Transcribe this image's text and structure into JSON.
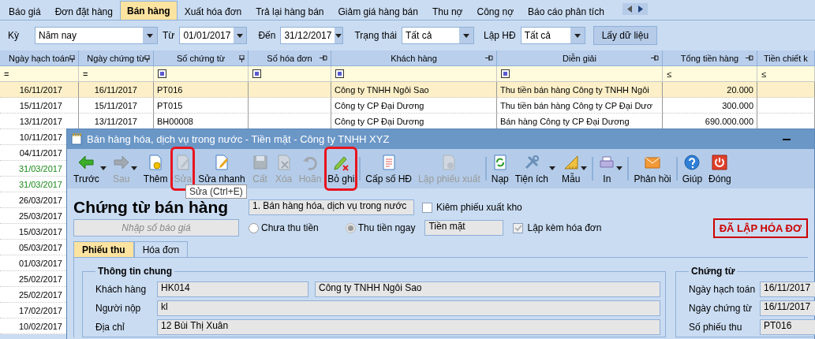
{
  "tabs": [
    {
      "label": "Báo giá",
      "selected": false
    },
    {
      "label": "Đơn đặt hàng",
      "selected": false
    },
    {
      "label": "Bán hàng",
      "selected": true
    },
    {
      "label": "Xuất hóa đơn",
      "selected": false
    },
    {
      "label": "Trả lại hàng bán",
      "selected": false
    },
    {
      "label": "Giảm giá hàng bán",
      "selected": false
    },
    {
      "label": "Thu nợ",
      "selected": false
    },
    {
      "label": "Công nợ",
      "selected": false
    },
    {
      "label": "Báo cáo phân tích",
      "selected": false
    }
  ],
  "filters": {
    "period_label": "Kỳ",
    "period": "Năm nay",
    "from_label": "Từ",
    "from": "01/01/2017",
    "to_label": "Đến",
    "to": "31/12/2017",
    "status_label": "Trạng thái",
    "status": "Tất cả",
    "invoice_label": "Lập HĐ",
    "invoice": "Tất cả",
    "button": "Lấy dữ liệu"
  },
  "table": {
    "columns": [
      {
        "label": "Ngày hạch toán",
        "pinned": true,
        "filter": {
          "kind": "text",
          "text": "="
        }
      },
      {
        "label": "Ngày chứng từ",
        "pinned": true,
        "filter": {
          "kind": "text",
          "text": "="
        }
      },
      {
        "label": "Số chứng từ",
        "pinned": true,
        "filter": {
          "kind": "box"
        }
      },
      {
        "label": "Số hóa đơn",
        "pinned": false,
        "filter": {
          "kind": "box"
        }
      },
      {
        "label": "Khách hàng",
        "pinned": false,
        "filter": {
          "kind": "box"
        }
      },
      {
        "label": "Diễn giải",
        "pinned": false,
        "filter": {
          "kind": "box"
        }
      },
      {
        "label": "Tổng tiền hàng",
        "pinned": false,
        "filter": {
          "kind": "text",
          "text": "≤"
        }
      },
      {
        "label": "Tiền chiết k",
        "filter": {
          "kind": "text",
          "text": "≤"
        }
      }
    ],
    "rows": [
      {
        "selected": true,
        "posting_date": "16/11/2017",
        "doc_date": "16/11/2017",
        "doc_no": "PT016",
        "customer": "Công ty TNHH Ngôi Sao",
        "description": "Thu tiền bán hàng Công ty TNHH Ngôi",
        "total": "20.000"
      },
      {
        "selected": false,
        "posting_date": "15/11/2017",
        "doc_date": "15/11/2017",
        "doc_no": "PT015",
        "customer": "Công ty CP Đại Dương",
        "description": "Thu tiền bán hàng Công ty CP Đại Dươ",
        "total": "300.000"
      },
      {
        "selected": false,
        "posting_date": "13/11/2017",
        "doc_date": "13/11/2017",
        "doc_no": "BH00008",
        "customer": "Công ty CP Đại Dương",
        "description": "Bán hàng Công ty CP Đại Dương",
        "total": "690.000.000"
      },
      {
        "selected": false,
        "posting_date": "10/11/2017"
      },
      {
        "selected": false,
        "posting_date": "04/11/2017"
      },
      {
        "selected": false,
        "color": "#1a8a1a",
        "posting_date": "31/03/2017"
      },
      {
        "selected": false,
        "color": "#1a8a1a",
        "posting_date": "31/03/2017"
      },
      {
        "selected": false,
        "posting_date": "26/03/2017"
      },
      {
        "selected": false,
        "posting_date": "25/03/2017"
      },
      {
        "selected": false,
        "posting_date": "15/03/2017"
      },
      {
        "selected": false,
        "posting_date": "05/03/2017"
      },
      {
        "selected": false,
        "posting_date": "01/03/2017"
      },
      {
        "selected": false,
        "posting_date": "25/02/2017"
      },
      {
        "selected": false,
        "posting_date": "25/02/2017"
      },
      {
        "selected": false,
        "posting_date": "17/02/2017"
      },
      {
        "selected": false,
        "posting_date": "10/02/2017"
      }
    ]
  },
  "dialog": {
    "title": "Bán hàng hóa, dịch vụ trong nước - Tiền mặt - Công ty TNHH XYZ",
    "toolbar": [
      {
        "kind": "back",
        "label": "Trước",
        "disabled": false,
        "dropdown": true,
        "highlighted": false,
        "separator_before": false
      },
      {
        "kind": "forward",
        "label": "Sau",
        "disabled": true,
        "dropdown": true,
        "highlighted": false,
        "separator_before": false
      },
      {
        "kind": "add",
        "label": "Thêm",
        "disabled": false,
        "dropdown": false,
        "highlighted": false,
        "separator_before": false
      },
      {
        "kind": "edit",
        "label": "Sửa",
        "disabled": true,
        "dropdown": false,
        "highlighted": true,
        "separator_before": false
      },
      {
        "kind": "quick_edit",
        "label": "Sửa nhanh",
        "disabled": false,
        "dropdown": false,
        "highlighted": false,
        "separator_before": false
      },
      {
        "kind": "save",
        "label": "Cất",
        "disabled": true,
        "dropdown": false,
        "highlighted": false,
        "separator_before": false
      },
      {
        "kind": "delete",
        "label": "Xóa",
        "disabled": true,
        "dropdown": false,
        "highlighted": false,
        "separator_before": false
      },
      {
        "kind": "undo",
        "label": "Hoãn",
        "disabled": true,
        "dropdown": false,
        "highlighted": false,
        "separator_before": false
      },
      {
        "kind": "unpost",
        "label": "Bỏ ghi",
        "disabled": false,
        "dropdown": false,
        "highlighted": true,
        "separator_before": false
      },
      {
        "kind": "number",
        "label": "Cấp số HĐ",
        "disabled": false,
        "dropdown": false,
        "highlighted": false,
        "separator_before": true
      },
      {
        "kind": "export",
        "label": "Lập phiếu xuất",
        "disabled": true,
        "dropdown": false,
        "highlighted": false,
        "separator_before": false
      },
      {
        "kind": "reload",
        "label": "Nạp",
        "disabled": false,
        "dropdown": false,
        "highlighted": false,
        "separator_before": true
      },
      {
        "kind": "tools",
        "label": "Tiện ích",
        "disabled": false,
        "dropdown": true,
        "highlighted": false,
        "separator_before": false
      },
      {
        "kind": "template",
        "label": "Mẫu",
        "disabled": false,
        "dropdown": true,
        "highlighted": false,
        "separator_before": false
      },
      {
        "kind": "print",
        "label": "In",
        "disabled": false,
        "dropdown": true,
        "highlighted": false,
        "separator_before": true
      },
      {
        "kind": "feedback",
        "label": "Phản hồi",
        "disabled": false,
        "dropdown": false,
        "highlighted": false,
        "separator_before": true
      },
      {
        "kind": "help",
        "label": "Giúp",
        "disabled": false,
        "dropdown": false,
        "highlighted": false,
        "separator_before": true
      },
      {
        "kind": "close",
        "label": "Đóng",
        "disabled": false,
        "dropdown": false,
        "highlighted": false,
        "separator_before": false
      }
    ],
    "tooltip": "Sửa (Ctrl+E)",
    "heading": "Chứng từ bán hàng",
    "sale_type": "1. Bán hàng hóa, dịch vụ trong nước",
    "export_check": {
      "label": "Kiêm phiếu xuất kho",
      "checked": false,
      "disabled": false
    },
    "quote": {
      "placeholder": "Nhập số báo giá"
    },
    "payment": [
      {
        "label": "Chưa thu tiền",
        "selected": false,
        "disabled": false
      },
      {
        "label": "Thu tiền ngay",
        "selected": true,
        "disabled": true
      }
    ],
    "payment_method": "Tiền mặt",
    "invoice_check": {
      "label": "Lập kèm hóa đơn",
      "checked": true,
      "disabled": true
    },
    "stamp": "ĐÃ LẬP HÓA ĐƠ",
    "tabs": [
      {
        "label": "Phiếu thu",
        "selected": true
      },
      {
        "label": "Hóa đơn",
        "selected": false
      }
    ],
    "general": {
      "title": "Thông tin chung",
      "customer_label": "Khách hàng",
      "customer_code": "HK014",
      "customer_name": "Công ty TNHH Ngôi Sao",
      "payer_label": "Người nộp",
      "payer": "kl",
      "address_label": "Địa chỉ",
      "address": "12 Bùi Thị Xuân"
    },
    "voucher": {
      "title": "Chứng từ",
      "fields": [
        {
          "label": "Ngày hạch toán",
          "value": "16/11/2017"
        },
        {
          "label": "Ngày chứng từ",
          "value": "16/11/2017"
        },
        {
          "label": "Số phiếu thu",
          "value": "PT016"
        }
      ]
    }
  }
}
